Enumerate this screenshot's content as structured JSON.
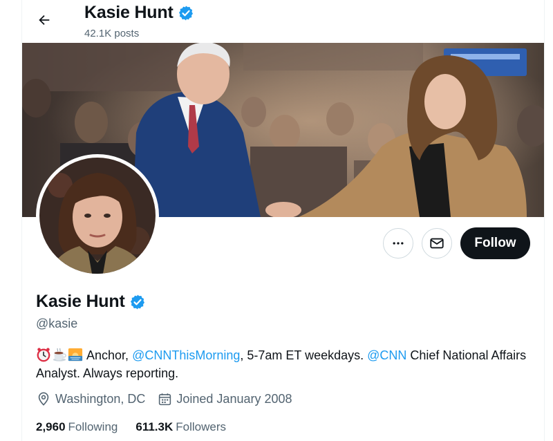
{
  "header": {
    "name": "Kasie Hunt",
    "posts": "42.1K posts"
  },
  "profile": {
    "name": "Kasie Hunt",
    "handle": "@kasie",
    "bio": {
      "part1": " Anchor, ",
      "mention1": "@CNNThisMorning",
      "part2": ", 5-7am ET weekdays. ",
      "mention2": "@CNN",
      "part3": " Chief National Affairs Analyst. Always reporting."
    },
    "location": "Washington, DC",
    "joined": "Joined January 2008",
    "following_count": "2,960",
    "following_label": "Following",
    "followers_count": "611.3K",
    "followers_label": "Followers"
  },
  "actions": {
    "follow_label": "Follow"
  },
  "icons": {
    "back": "arrow-left-icon",
    "verified": "verified-badge-icon",
    "more": "more-icon",
    "message": "envelope-icon",
    "location": "location-pin-icon",
    "calendar": "calendar-icon"
  },
  "colors": {
    "accent": "#1d9bf0",
    "text": "#0f1419",
    "secondary": "#536471",
    "follow_bg": "#0f1419"
  }
}
